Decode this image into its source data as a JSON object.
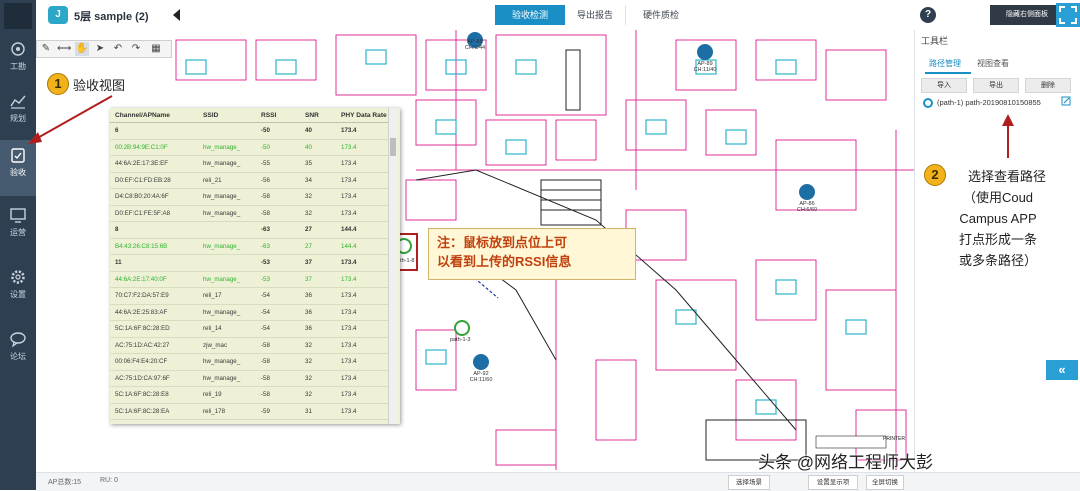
{
  "app": {
    "project_icon": "J",
    "project_title": "5层 sample (2)",
    "tabs": [
      {
        "label": "验收检测",
        "active": true
      },
      {
        "label": "导出报告",
        "active": false
      },
      {
        "label": "硬件质检",
        "active": false
      }
    ],
    "help_label": "?",
    "panel_toggle_label": "隐藏右侧面板"
  },
  "sidebar": {
    "items": [
      {
        "label": "工勘",
        "icon": "toolbox-icon",
        "active": false
      },
      {
        "label": "规划",
        "icon": "chart-icon",
        "active": false
      },
      {
        "label": "验收",
        "icon": "clipboard-check-icon",
        "active": true
      },
      {
        "label": "运营",
        "icon": "monitor-icon",
        "active": false
      },
      {
        "label": "设置",
        "icon": "gear-icon",
        "active": false
      },
      {
        "label": "论坛",
        "icon": "chat-icon",
        "active": false
      }
    ]
  },
  "toolbar": {
    "tools": [
      "pencil-icon",
      "ruler-icon",
      "hand-icon",
      "pointer-icon",
      "undo-icon",
      "redo-icon",
      "grid-icon"
    ]
  },
  "table": {
    "columns": [
      "Channel/APName",
      "SSID",
      "RSSI",
      "SNR",
      "PHY Data Rate"
    ],
    "rows": [
      {
        "type": "group",
        "cells": [
          "6",
          "",
          "-50",
          "40",
          "173.4"
        ]
      },
      {
        "type": "highlight",
        "cells": [
          "00:2B:94:9E:C1:0F",
          "hw_manage_",
          "-50",
          "40",
          "173.4"
        ]
      },
      {
        "type": "normal",
        "cells": [
          "44:6A:2E:17:3E:EF",
          "hw_manage_",
          "-55",
          "35",
          "173.4"
        ]
      },
      {
        "type": "normal",
        "cells": [
          "D0:EF:C1:FD:EB:28",
          "reli_21",
          "-56",
          "34",
          "173.4"
        ]
      },
      {
        "type": "normal",
        "cells": [
          "D4:C8:B0:20:4A:6F",
          "hw_manage_",
          "-58",
          "32",
          "173.4"
        ]
      },
      {
        "type": "normal",
        "cells": [
          "D0:EF:C1:FE:5F:A8",
          "hw_manage_",
          "-58",
          "32",
          "173.4"
        ]
      },
      {
        "type": "group",
        "cells": [
          "8",
          "",
          "-63",
          "27",
          "144.4"
        ]
      },
      {
        "type": "highlight",
        "cells": [
          "B4:43:26:C8:15:6B",
          "hw_manage_",
          "-63",
          "27",
          "144.4"
        ]
      },
      {
        "type": "group",
        "cells": [
          "11",
          "",
          "-53",
          "37",
          "173.4"
        ]
      },
      {
        "type": "highlight",
        "cells": [
          "44:6A:2E:17:40:0F",
          "hw_manage_",
          "-53",
          "37",
          "173.4"
        ]
      },
      {
        "type": "normal",
        "cells": [
          "70:C7:F2:DA:57:E9",
          "reli_17",
          "-54",
          "36",
          "173.4"
        ]
      },
      {
        "type": "normal",
        "cells": [
          "44:6A:2E:25:83:AF",
          "hw_manage_",
          "-54",
          "36",
          "173.4"
        ]
      },
      {
        "type": "normal",
        "cells": [
          "5C:1A:6F:8C:28:ED",
          "reli_14",
          "-54",
          "36",
          "173.4"
        ]
      },
      {
        "type": "normal",
        "cells": [
          "AC:75:1D:AC:42:27",
          "zjw_mac",
          "-58",
          "32",
          "173.4"
        ]
      },
      {
        "type": "normal",
        "cells": [
          "00:06:F4:E4:20:CF",
          "hw_manage_",
          "-58",
          "32",
          "173.4"
        ]
      },
      {
        "type": "normal",
        "cells": [
          "AC:75:1D:CA:97:6F",
          "hw_manage_",
          "-58",
          "32",
          "173.4"
        ]
      },
      {
        "type": "normal",
        "cells": [
          "5C:1A:6F:8C:28:E8",
          "reli_19",
          "-58",
          "32",
          "173.4"
        ]
      },
      {
        "type": "normal",
        "cells": [
          "5C:1A:6F:8C:28:EA",
          "reli_178",
          "-59",
          "31",
          "173.4"
        ]
      },
      {
        "type": "normal",
        "cells": [
          "5C:1A:6F:8D:89:C8",
          "hw_manage_",
          "-63",
          "27",
          "173.4"
        ]
      }
    ]
  },
  "annotations": {
    "step1_number": "1",
    "step1_text": "验收视图",
    "step2_number": "2",
    "step2_lines": [
      "选择查看路径",
      "（使用Coud",
      "Campus APP",
      "打点形成一条",
      "或多条路径）"
    ],
    "callout_lines": [
      "注：鼠标放到点位上可",
      "以看到上传的RSSI信息"
    ]
  },
  "map": {
    "aps": [
      {
        "name": "AP-88",
        "channel": "CH:1/44"
      },
      {
        "name": "AP-89",
        "channel": "CH:11/40"
      },
      {
        "name": "AP-86",
        "channel": "CH:6/60"
      },
      {
        "name": "AP-92",
        "channel": "CH:11/60"
      }
    ],
    "points": [
      {
        "label": "path-1-8"
      },
      {
        "label": "path-1-3"
      }
    ],
    "printer_label": "PRINTER"
  },
  "right_panel": {
    "title": "工具栏",
    "tabs": [
      {
        "label": "路径管理",
        "active": true
      },
      {
        "label": "视图查看",
        "active": false
      }
    ],
    "buttons": [
      "导入",
      "导出",
      "删除"
    ],
    "path_label": "(path-1) path-20190810150855"
  },
  "status_bar": {
    "ap_total": "AP总数:15",
    "ru_count": "RU: 0",
    "buttons": [
      "选择场景",
      "设置显示项",
      "全屏切换"
    ]
  },
  "watermark": "头条 @网络工程师大彭",
  "colors": {
    "sidebar": "#2f3f52",
    "accent": "#1a8fc6",
    "highlight_text": "#2fb32f",
    "callout_text": "#c0410d",
    "step_circle": "#f2b21c",
    "floorplan_magenta": "#e0309a",
    "floorplan_cyan": "#2bb3c9"
  }
}
